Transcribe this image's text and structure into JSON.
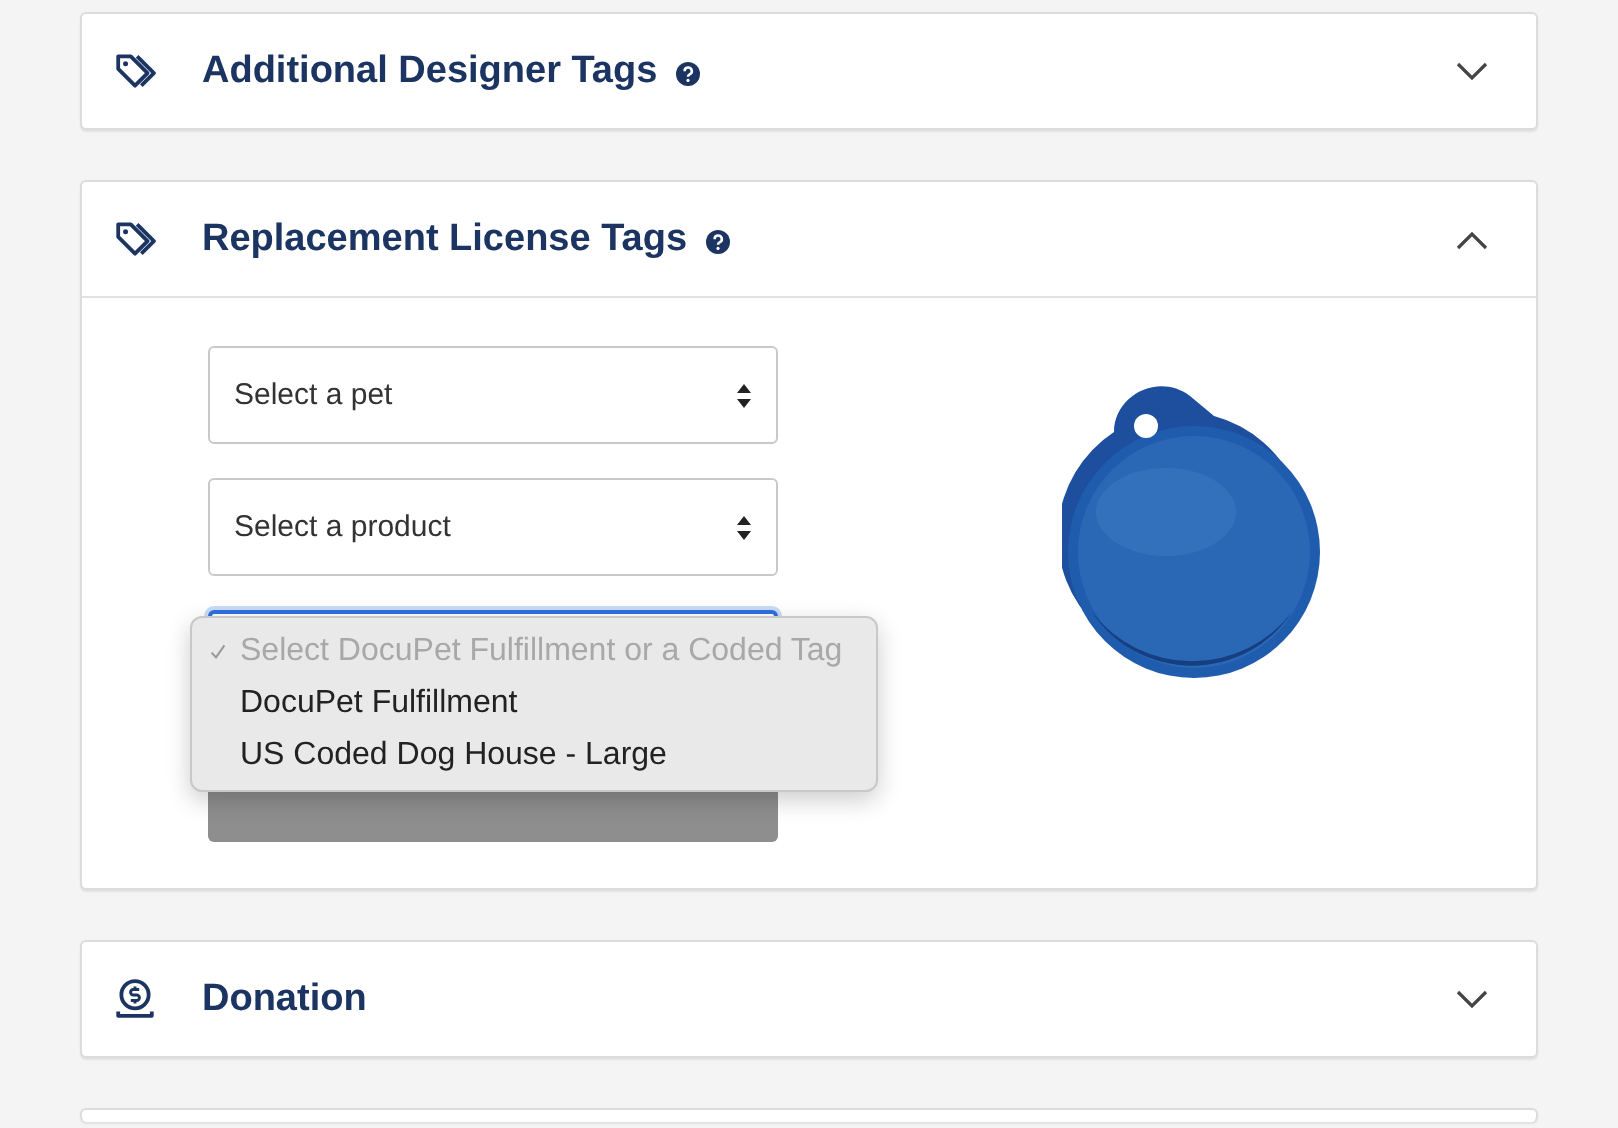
{
  "sections": [
    {
      "title": "Additional Designer Tags",
      "kind": "tag",
      "help": true,
      "expanded": false
    },
    {
      "title": "Replacement License Tags",
      "kind": "tag",
      "help": true,
      "expanded": true,
      "selects": [
        {
          "value": "Select a pet",
          "focused": false
        },
        {
          "value": "Select a product",
          "focused": false
        },
        {
          "focused": true
        }
      ],
      "product_image": {
        "kind": "picture"
      },
      "dropdown": {
        "options": [
          {
            "label": "Select DocuPet Fulfillment or a Coded Tag",
            "selected": true,
            "disabled": true
          },
          {
            "label": "DocuPet Fulfillment",
            "selected": false,
            "disabled": false
          },
          {
            "label": "US Coded Dog House - Large",
            "selected": false,
            "disabled": false
          }
        ]
      }
    },
    {
      "title": "Donation",
      "kind": "donation",
      "help": false,
      "expanded": false
    },
    {
      "kind": "blank"
    }
  ]
}
